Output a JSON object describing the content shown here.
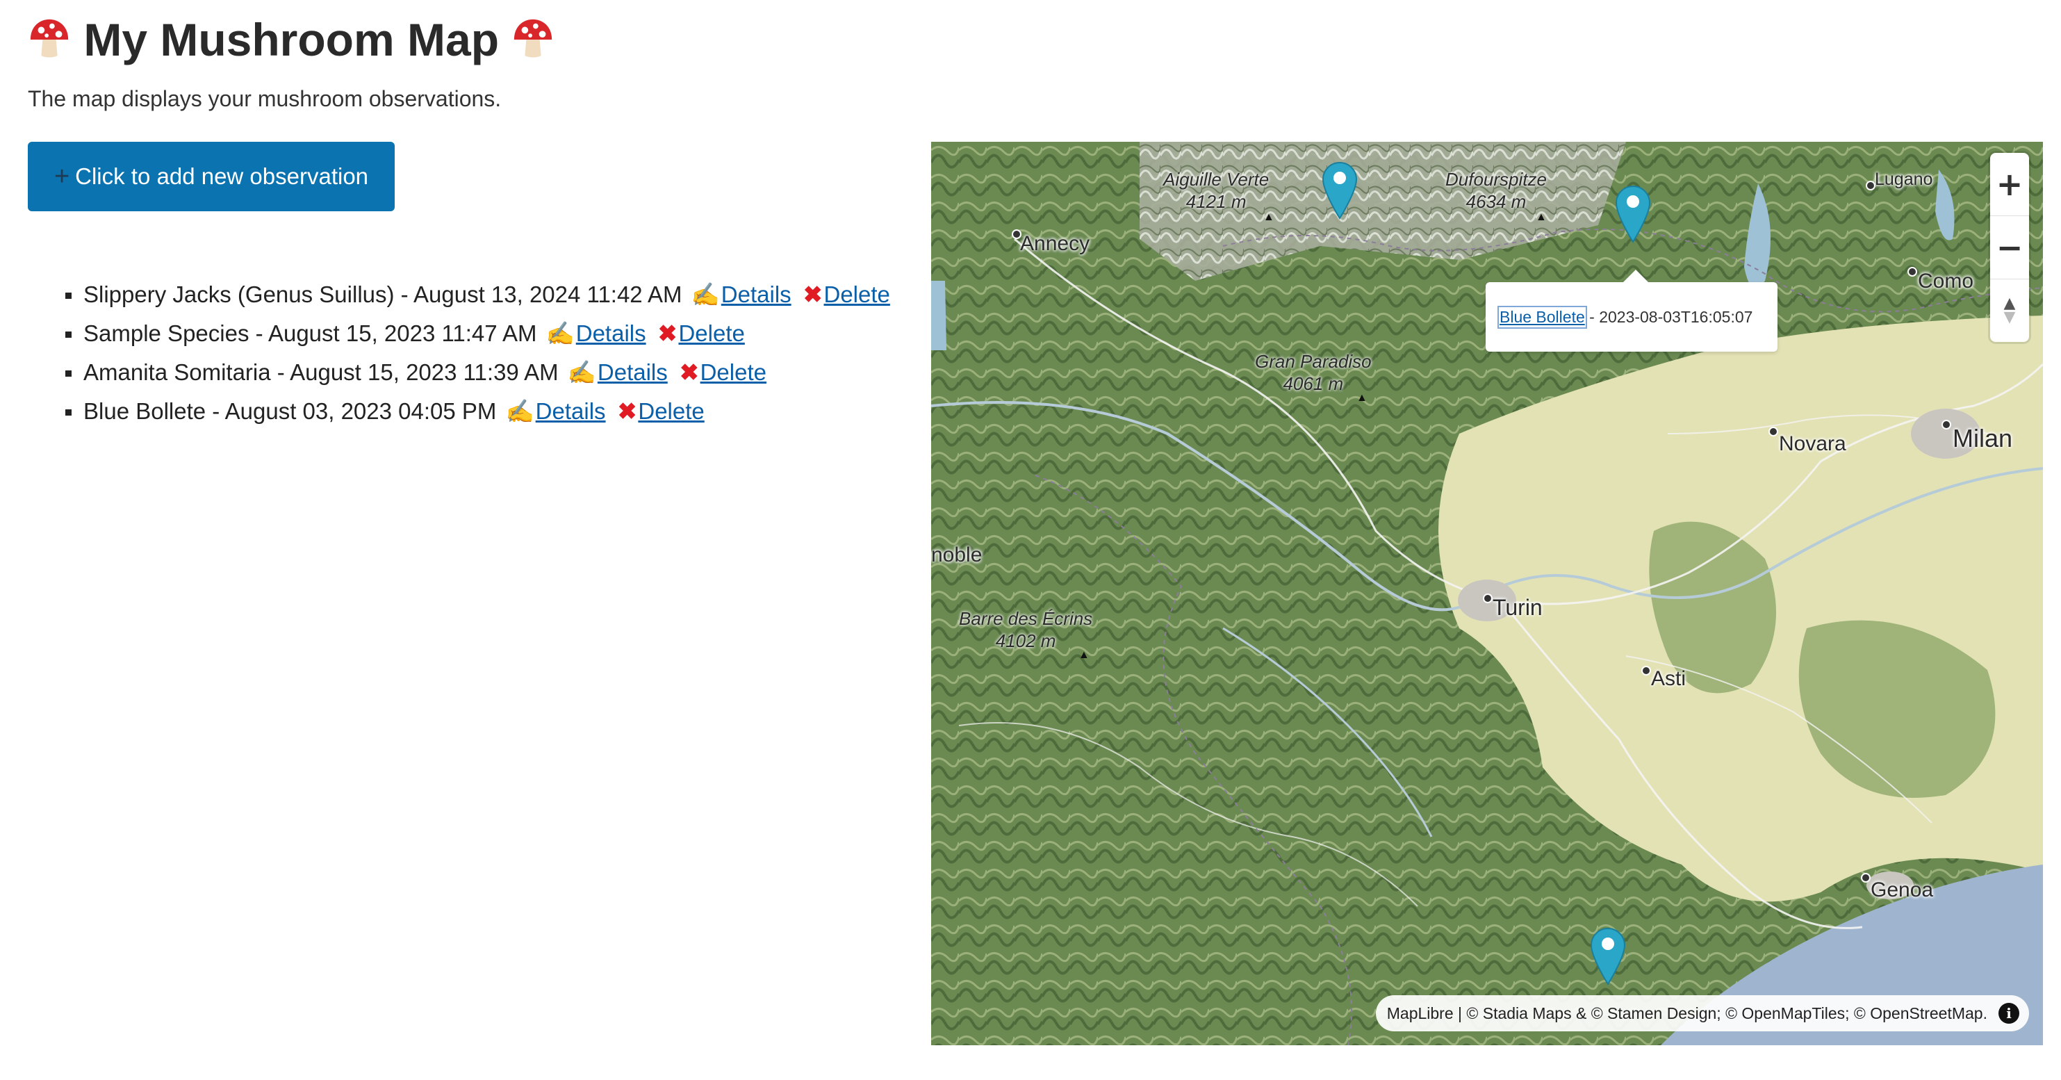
{
  "page": {
    "title": "My Mushroom Map",
    "title_icon": "mushroom-emoji",
    "intro": "The map displays your mushroom observations.",
    "add_button": {
      "icon": "plus-icon",
      "icon_glyph": "+",
      "label": "Click to add new observation"
    }
  },
  "observations": [
    {
      "text": "Slippery Jacks (Genus Suillus) - August 13, 2024 11:42 AM",
      "details_label": "Details",
      "delete_label": "Delete"
    },
    {
      "text": "Sample Species - August 15, 2023 11:47 AM",
      "details_label": "Details",
      "delete_label": "Delete"
    },
    {
      "text": "Amanita Somitaria - August 15, 2023 11:39 AM",
      "details_label": "Details",
      "delete_label": "Delete"
    },
    {
      "text": "Blue Bollete - August 03, 2023 04:05 PM",
      "details_label": "Details",
      "delete_label": "Delete"
    }
  ],
  "map": {
    "places": {
      "lugano": "Lugano",
      "como": "Como",
      "annecy": "Annecy",
      "novara": "Novara",
      "milan": "Milan",
      "grenoble": "noble",
      "turin": "Turin",
      "asti": "Asti",
      "genoa": "Genoa"
    },
    "peaks": {
      "aiguille_name": "Aiguille Verte",
      "aiguille_alt": "4121 m",
      "dufour_name": "Dufourspitze",
      "dufour_alt": "4634 m",
      "gran_name": "Gran Paradiso",
      "gran_alt": "4061 m",
      "barre_name": "Barre des Écrins",
      "barre_alt": "4102 m"
    },
    "zoom_in": "+",
    "zoom_out": "−",
    "compass": "▲",
    "popup": {
      "link": "Blue Bollete",
      "text": " - 2023-08-03T16:05:07"
    },
    "attribution": "MapLibre | © Stadia Maps & © Stamen Design; © OpenMapTiles; © OpenStreetMap.",
    "info_glyph": "i",
    "marker_color": "#2aa6c8"
  }
}
